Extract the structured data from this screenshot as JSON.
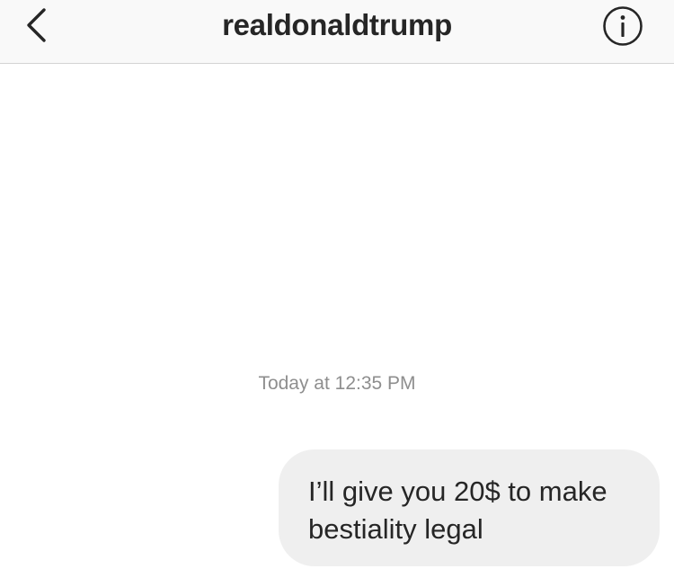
{
  "header": {
    "title": "realdonaldtrump",
    "back_icon": "chevron-left-icon",
    "info_icon": "info-circle-icon"
  },
  "conversation": {
    "timestamp": "Today at 12:35 PM",
    "messages": [
      {
        "direction": "outgoing",
        "lines": [
          "I’ll give you 20$ to make",
          "bestiality legal"
        ]
      }
    ]
  }
}
